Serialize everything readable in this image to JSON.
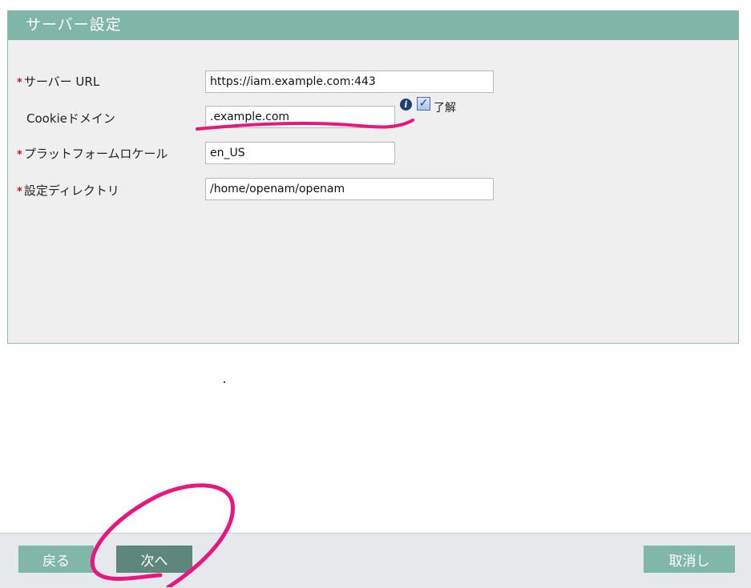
{
  "panel": {
    "title": "サーバー設定"
  },
  "fields": [
    {
      "label": "サーバー URL",
      "required": "*",
      "value": "https://iam.example.com:443"
    },
    {
      "label": "Cookieドメイン",
      "required": "",
      "value": ".example.com"
    },
    {
      "label": "プラットフォームロケール",
      "required": "*",
      "value": "en_US"
    },
    {
      "label": "設定ディレクトリ",
      "required": "*",
      "value": "/home/openam/openam"
    }
  ],
  "cookie_info": {
    "icon": "info-icon",
    "checkbox_checked": true,
    "checkbox_label": "了解"
  },
  "footer": {
    "back_label": "戻る",
    "next_label": "次へ",
    "cancel_label": "取消し"
  },
  "colors": {
    "header": "#7fb6a7",
    "button": "#80b7a8",
    "button_active": "#5f867a",
    "annotation": "#e8177f",
    "required": "#d0112b"
  }
}
